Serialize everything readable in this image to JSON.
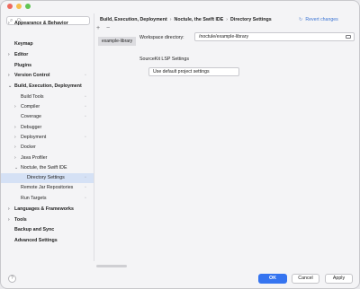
{
  "search": {
    "placeholder": "Q-"
  },
  "sidebar": {
    "items": [
      {
        "label": "Appearance & Behavior",
        "chevron": "›",
        "bold": true
      },
      {
        "label": "Keymap",
        "bold": true
      },
      {
        "label": "Editor",
        "chevron": "›",
        "bold": true
      },
      {
        "label": "Plugins",
        "bold": true
      },
      {
        "label": "Version Control",
        "chevron": "›",
        "bold": true,
        "mark": "▫"
      },
      {
        "label": "Build, Execution, Deployment",
        "chevron": "⌄",
        "bold": true
      },
      {
        "label": "Build Tools",
        "mark": "▫"
      },
      {
        "label": "Compiler",
        "chevron": "›",
        "mark": "▫"
      },
      {
        "label": "Coverage",
        "mark": "▫"
      },
      {
        "label": "Debugger",
        "chevron": "›"
      },
      {
        "label": "Deployment",
        "chevron": "›",
        "mark": "▫"
      },
      {
        "label": "Docker",
        "chevron": "›"
      },
      {
        "label": "Java Profiler",
        "chevron": "›"
      },
      {
        "label": "Noctule, the Swift IDE",
        "chevron": "⌄"
      },
      {
        "label": "Directory Settings",
        "mark": "▫",
        "selected": true
      },
      {
        "label": "Remote Jar Repositories",
        "mark": "▫"
      },
      {
        "label": "Run Targets",
        "mark": "▫"
      },
      {
        "label": "Languages & Frameworks",
        "chevron": "›",
        "bold": true
      },
      {
        "label": "Tools",
        "chevron": "›",
        "bold": true
      },
      {
        "label": "Backup and Sync",
        "bold": true
      },
      {
        "label": "Advanced Settings",
        "bold": true
      }
    ]
  },
  "breadcrumb": {
    "parts": [
      "Build, Execution, Deployment",
      "Noctule, the Swift IDE",
      "Directory Settings"
    ],
    "separator": "›"
  },
  "revert": {
    "icon": "↻",
    "label": "Revert changes"
  },
  "toolbar": {
    "add": "+",
    "remove": "−"
  },
  "entry": {
    "label": "example-library"
  },
  "workspace": {
    "label": "Workspace directory:",
    "value": "/noctule/example-library"
  },
  "sourcekit": {
    "label": "SourceKit LSP Settings",
    "value": "Use default project settings"
  },
  "footer": {
    "help": "?",
    "ok": "OK",
    "cancel": "Cancel",
    "apply": "Apply"
  }
}
